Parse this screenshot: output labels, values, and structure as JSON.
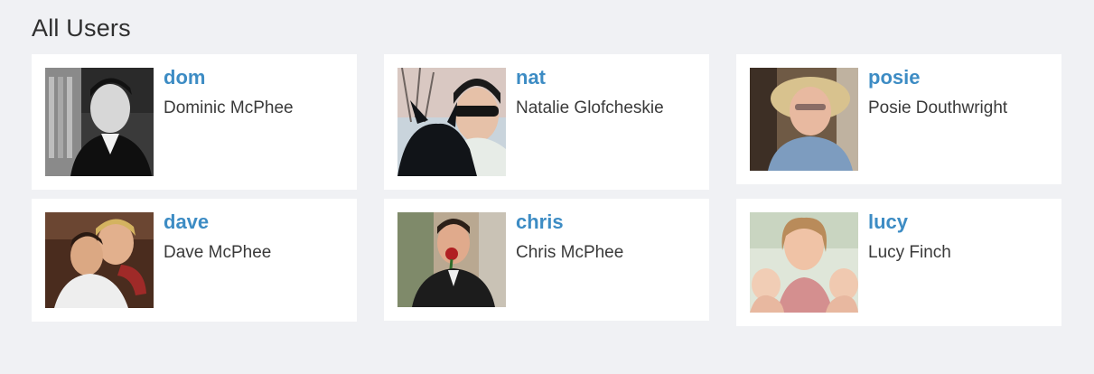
{
  "page": {
    "title": "All Users"
  },
  "users": [
    {
      "username": "dom",
      "full_name": "Dominic McPhee",
      "avatar": "photo-man-suit-bw"
    },
    {
      "username": "nat",
      "full_name": "Natalie Glofcheskie",
      "avatar": "photo-woman-with-dog"
    },
    {
      "username": "posie",
      "full_name": "Posie Douthwright",
      "avatar": "photo-woman-sunhat"
    },
    {
      "username": "dave",
      "full_name": "Dave McPhee",
      "avatar": "photo-couple-hug"
    },
    {
      "username": "chris",
      "full_name": "Chris McPhee",
      "avatar": "photo-man-rose"
    },
    {
      "username": "lucy",
      "full_name": "Lucy Finch",
      "avatar": "photo-woman-twins"
    }
  ],
  "colors": {
    "background": "#f0f1f4",
    "card": "#ffffff",
    "link": "#3d8cc4",
    "text": "#3a3a3a"
  }
}
